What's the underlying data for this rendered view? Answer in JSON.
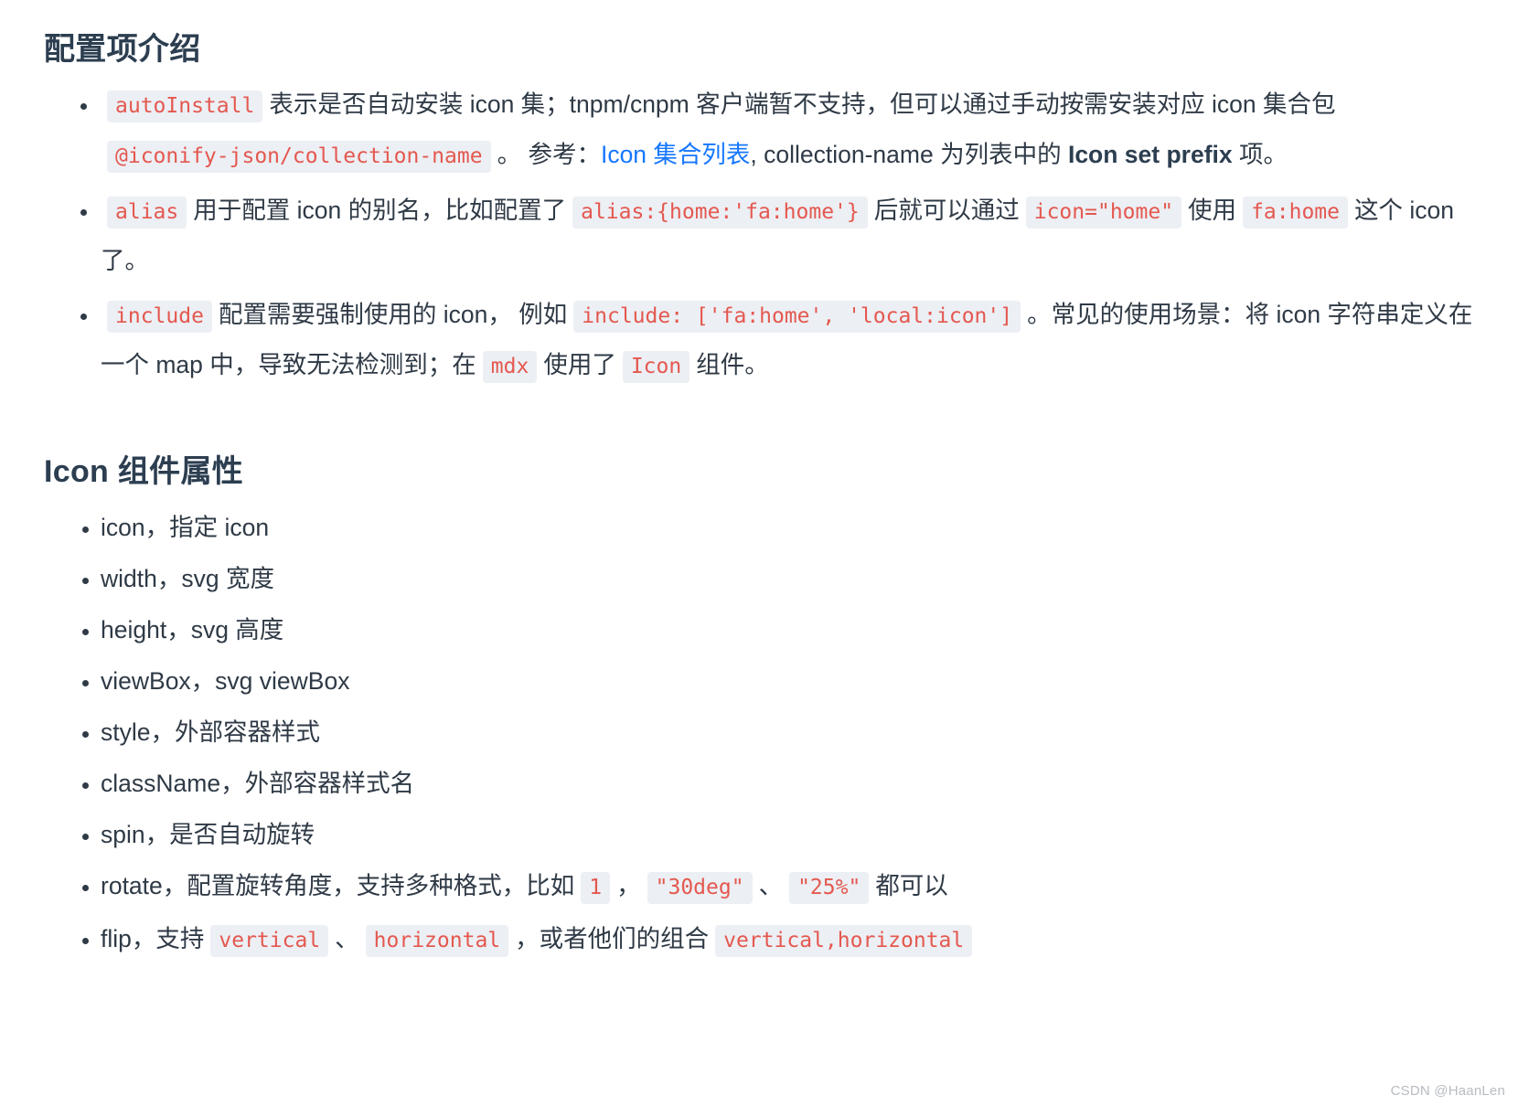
{
  "colors": {
    "text": "#2f3a46",
    "heading": "#2c3e50",
    "code_text": "#e4584f",
    "code_bg": "#eceff4",
    "link": "#1677ff",
    "watermark": "#b8bcc2",
    "background": "#ffffff"
  },
  "sections": [
    {
      "heading": "配置项介绍",
      "items": [
        {
          "id": "autoinstall",
          "parts": [
            {
              "type": "code",
              "text": "autoInstall"
            },
            {
              "type": "text",
              "text": "表示是否自动安装 icon 集；tnpm/cnpm 客户端暂不支持，但可以通过手动按需安装对应 icon 集合包 "
            },
            {
              "type": "code",
              "text": "@iconify-json/collection-name"
            },
            {
              "type": "text",
              "text": "。 参考："
            },
            {
              "type": "link",
              "text": "Icon 集合列表"
            },
            {
              "type": "text",
              "text": ", collection-name 为列表中的 "
            },
            {
              "type": "bold",
              "text": "Icon set prefix"
            },
            {
              "type": "text",
              "text": " 项。"
            }
          ]
        },
        {
          "id": "alias",
          "parts": [
            {
              "type": "code",
              "text": "alias"
            },
            {
              "type": "text",
              "text": "用于配置 icon 的别名，比如配置了"
            },
            {
              "type": "code",
              "text": "alias:{home:'fa:home'}"
            },
            {
              "type": "text",
              "text": "后就可以通过"
            },
            {
              "type": "code",
              "text": "icon=\"home\""
            },
            {
              "type": "text",
              "text": "使用"
            },
            {
              "type": "code",
              "text": "fa:home"
            },
            {
              "type": "text",
              "text": "这个 icon 了。"
            }
          ]
        },
        {
          "id": "include",
          "parts": [
            {
              "type": "code",
              "text": "include"
            },
            {
              "type": "text",
              "text": "配置需要强制使用的 icon， 例如"
            },
            {
              "type": "code",
              "text": "include: ['fa:home', 'local:icon']"
            },
            {
              "type": "text",
              "text": "。常见的使用场景：将 icon 字符串定义在一个 map 中，导致无法检测到；在"
            },
            {
              "type": "code",
              "text": "mdx"
            },
            {
              "type": "text",
              "text": "使用了"
            },
            {
              "type": "code",
              "text": "Icon"
            },
            {
              "type": "text",
              "text": "组件。"
            }
          ]
        }
      ]
    },
    {
      "heading": "Icon 组件属性",
      "items": [
        {
          "id": "icon",
          "parts": [
            {
              "type": "text",
              "text": "icon，指定 icon"
            }
          ]
        },
        {
          "id": "width",
          "parts": [
            {
              "type": "text",
              "text": "width，svg 宽度"
            }
          ]
        },
        {
          "id": "height",
          "parts": [
            {
              "type": "text",
              "text": "height，svg 高度"
            }
          ]
        },
        {
          "id": "viewbox",
          "parts": [
            {
              "type": "text",
              "text": "viewBox，svg viewBox"
            }
          ]
        },
        {
          "id": "style",
          "parts": [
            {
              "type": "text",
              "text": "style，外部容器样式"
            }
          ]
        },
        {
          "id": "classname",
          "parts": [
            {
              "type": "text",
              "text": "className，外部容器样式名"
            }
          ]
        },
        {
          "id": "spin",
          "parts": [
            {
              "type": "text",
              "text": "spin，是否自动旋转"
            }
          ]
        },
        {
          "id": "rotate",
          "parts": [
            {
              "type": "text",
              "text": "rotate，配置旋转角度，支持多种格式，比如"
            },
            {
              "type": "code",
              "text": "1"
            },
            {
              "type": "text",
              "text": "，"
            },
            {
              "type": "code",
              "text": "\"30deg\""
            },
            {
              "type": "text",
              "text": "、"
            },
            {
              "type": "code",
              "text": "\"25%\""
            },
            {
              "type": "text",
              "text": "都可以"
            }
          ]
        },
        {
          "id": "flip",
          "parts": [
            {
              "type": "text",
              "text": "flip，支持"
            },
            {
              "type": "code",
              "text": "vertical"
            },
            {
              "type": "text",
              "text": "、"
            },
            {
              "type": "code",
              "text": "horizontal"
            },
            {
              "type": "text",
              "text": "，或者他们的组合"
            },
            {
              "type": "code",
              "text": "vertical,horizontal"
            }
          ]
        }
      ]
    }
  ],
  "watermark": "CSDN @HaanLen"
}
